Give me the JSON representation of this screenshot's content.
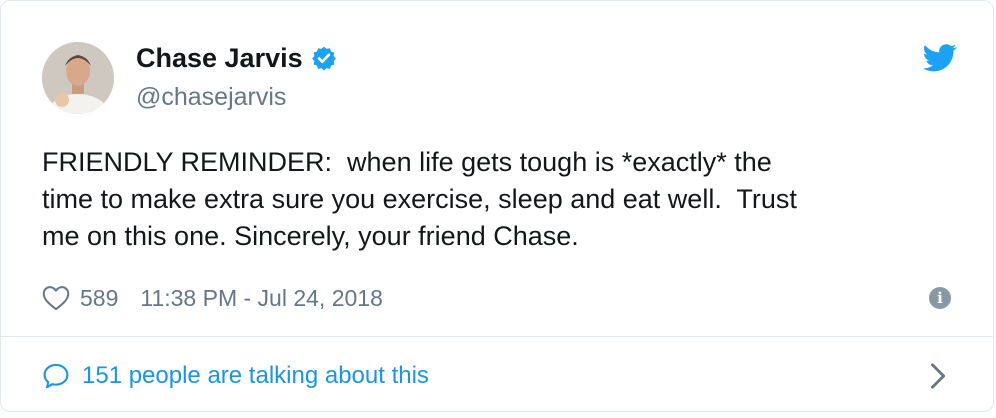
{
  "author": {
    "display_name": "Chase Jarvis",
    "handle": "@chasejarvis",
    "verified": true
  },
  "tweet": {
    "text": "FRIENDLY REMINDER:  when life gets tough is *exactly* the\ntime to make extra sure you exercise, sleep and eat well.  Trust\nme on this one. Sincerely, your friend Chase.",
    "likes": "589",
    "timestamp": "11:38 PM - Jul 24, 2018"
  },
  "footer": {
    "talking_label": "151 people are talking about this"
  },
  "colors": {
    "text": "#14171a",
    "secondary": "#657786",
    "accent": "#1b95e0",
    "verified_badge": "#1da1f2",
    "border": "#e1e8ed"
  },
  "icons": {
    "verified": "verified-badge-icon",
    "brand": "twitter-bird-icon",
    "like": "heart-icon",
    "info": "info-icon",
    "reply": "speech-bubble-icon",
    "expand": "chevron-right-icon"
  }
}
